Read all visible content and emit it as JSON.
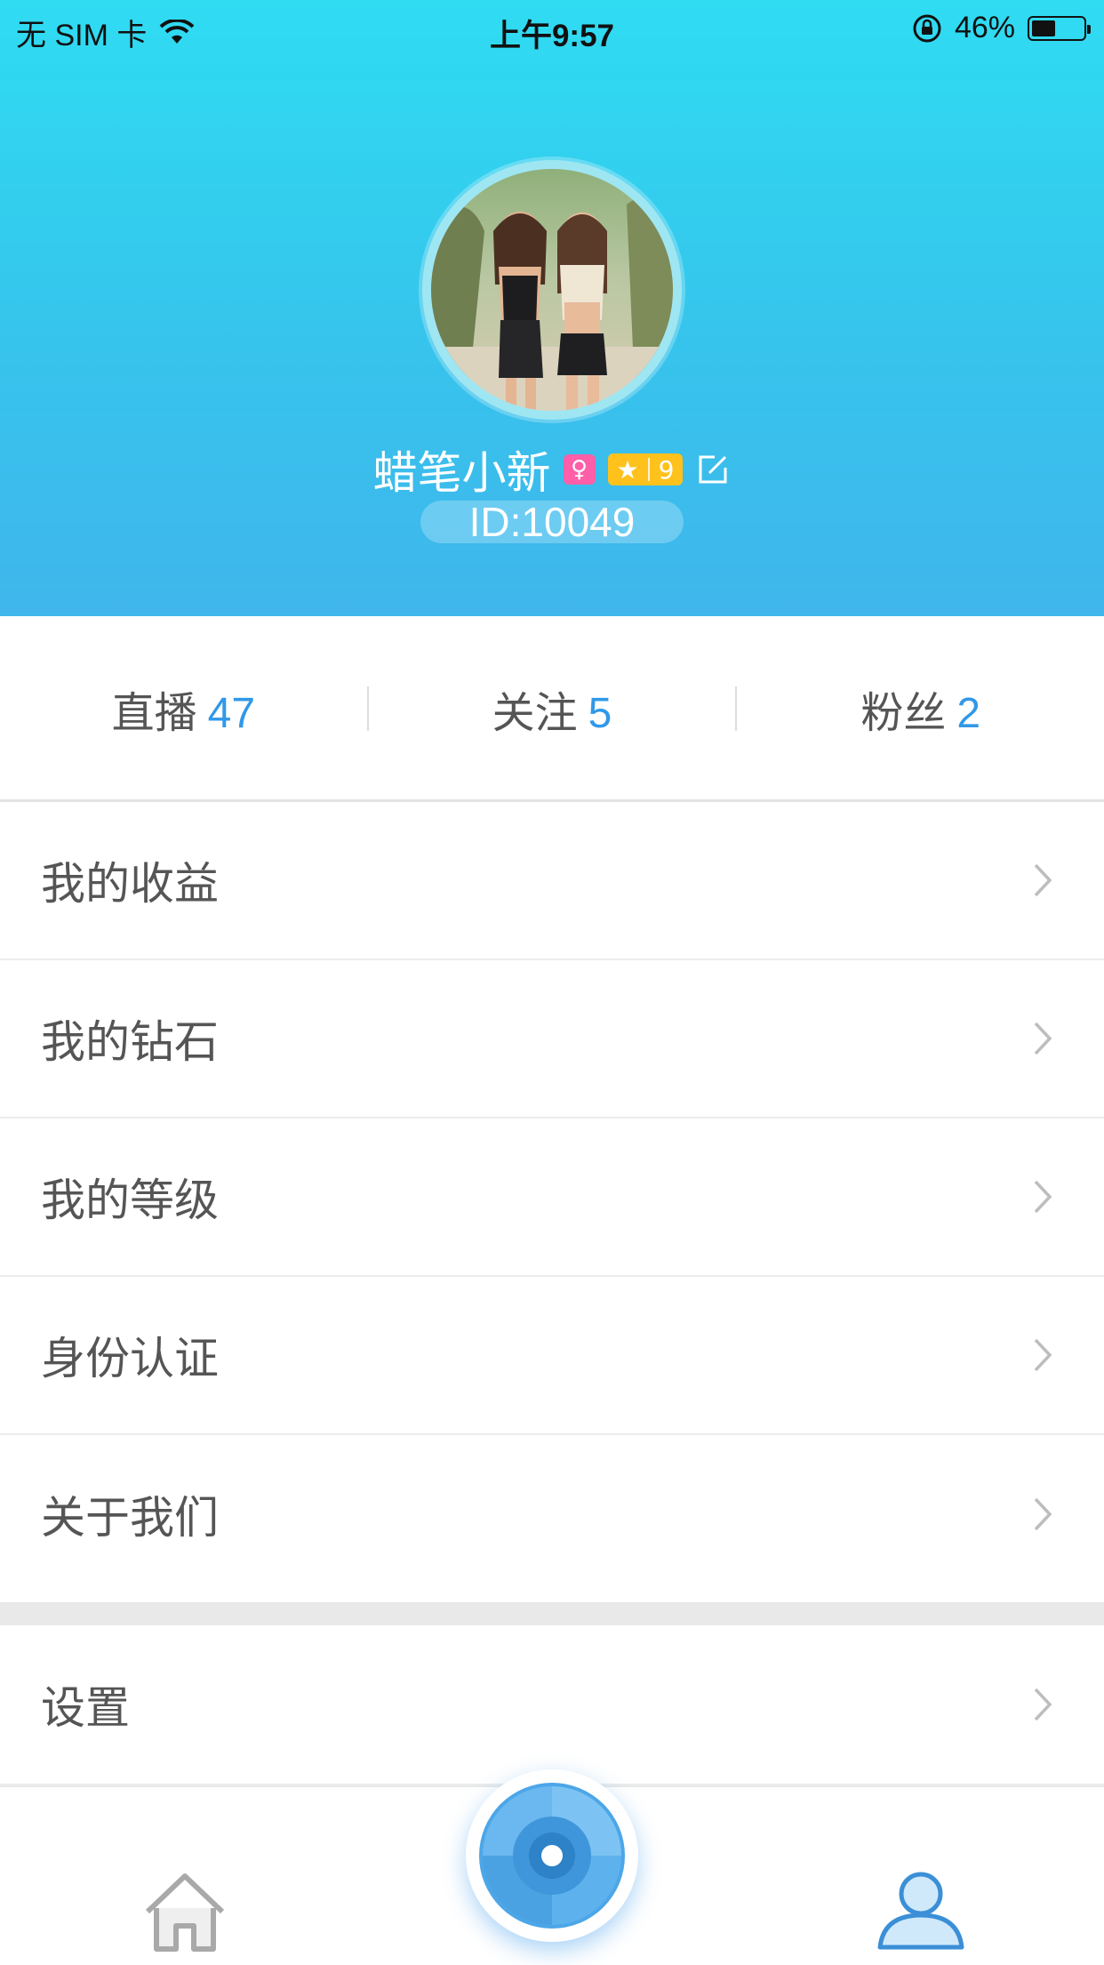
{
  "status_bar": {
    "carrier": "无 SIM 卡",
    "time": "上午9:57",
    "battery": "46%",
    "battery_level": 0.46
  },
  "profile": {
    "username": "蜡笔小新",
    "gender_icon": "female-icon",
    "level": "9",
    "id": "ID:10049"
  },
  "stats": [
    {
      "label": "直播",
      "value": "47"
    },
    {
      "label": "关注",
      "value": "5"
    },
    {
      "label": "粉丝",
      "value": "2"
    }
  ],
  "menu": {
    "items": [
      {
        "label": "我的收益"
      },
      {
        "label": "我的钻石"
      },
      {
        "label": "我的等级"
      },
      {
        "label": "身份认证"
      },
      {
        "label": "关于我们"
      }
    ],
    "settings": {
      "label": "设置"
    }
  },
  "tabbar": {
    "items": [
      {
        "icon": "home-icon",
        "active": false
      },
      {
        "icon": "live-camera-icon",
        "active": false
      },
      {
        "icon": "profile-icon",
        "active": true
      }
    ]
  },
  "colors": {
    "header_top": "#2fdcf2",
    "header_bottom": "#40b6ec",
    "accent": "#3198e8",
    "level_badge": "#ffc21c",
    "gender_badge": "#ff5ea8"
  }
}
